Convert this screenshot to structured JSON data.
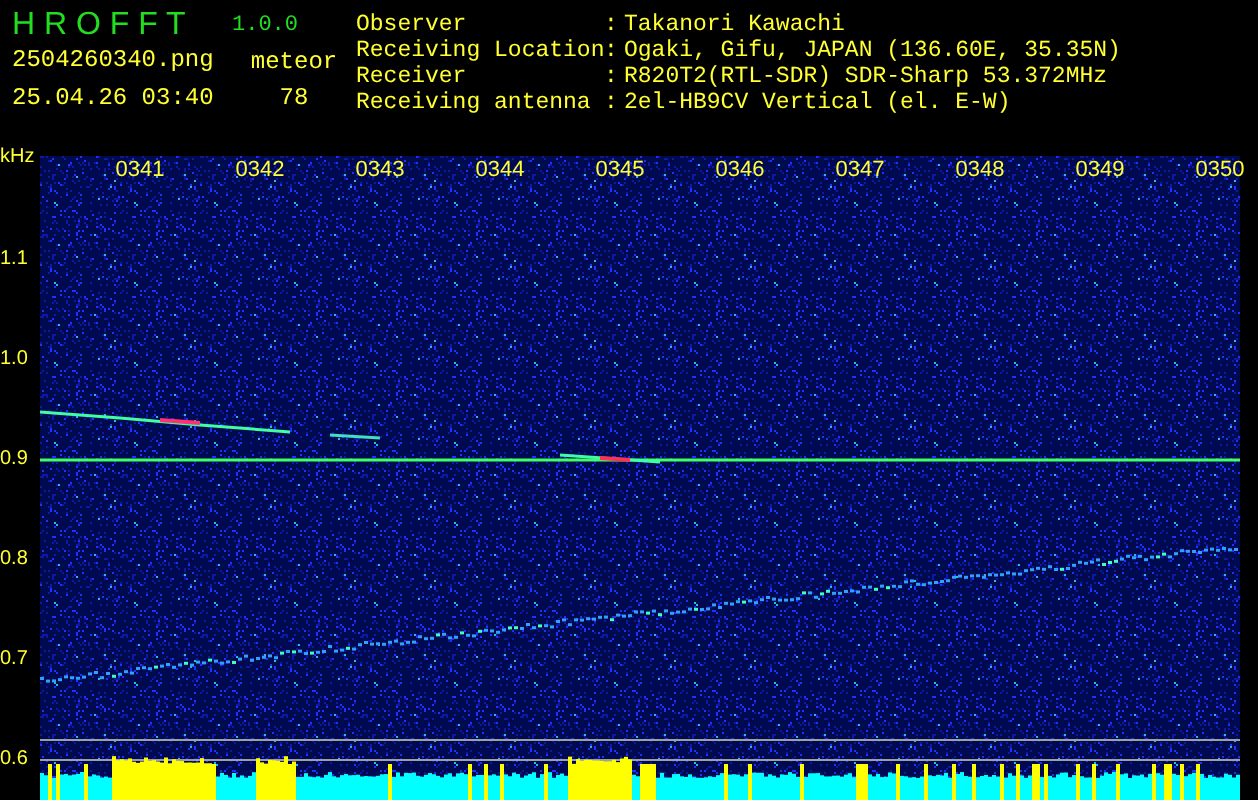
{
  "app": {
    "name": "H R O F F T",
    "version": "1.0.0"
  },
  "file": "2504260340.png",
  "datetime": "25.04.26 03:40",
  "meteor": {
    "label": "meteor",
    "count": "78"
  },
  "station": [
    {
      "label": "Observer",
      "separator": ":",
      "value": "Takanori Kawachi"
    },
    {
      "label": "Receiving Location",
      "separator": ":",
      "value": "Ogaki, Gifu, JAPAN (136.60E, 35.35N)"
    },
    {
      "label": "Receiver",
      "separator": ":",
      "value": "R820T2(RTL-SDR) SDR-Sharp 53.372MHz"
    },
    {
      "label": "Receiving antenna",
      "separator": ":",
      "value": "2el-HB9CV Vertical (el. E-W)"
    }
  ],
  "axis": {
    "unit": "kHz",
    "times": [
      "0341",
      "0342",
      "0343",
      "0344",
      "0345",
      "0346",
      "0347",
      "0348",
      "0349",
      "0350"
    ],
    "freqs": [
      "1.1",
      "1.0",
      "0.9",
      "0.8",
      "0.7",
      "0.6"
    ]
  }
}
